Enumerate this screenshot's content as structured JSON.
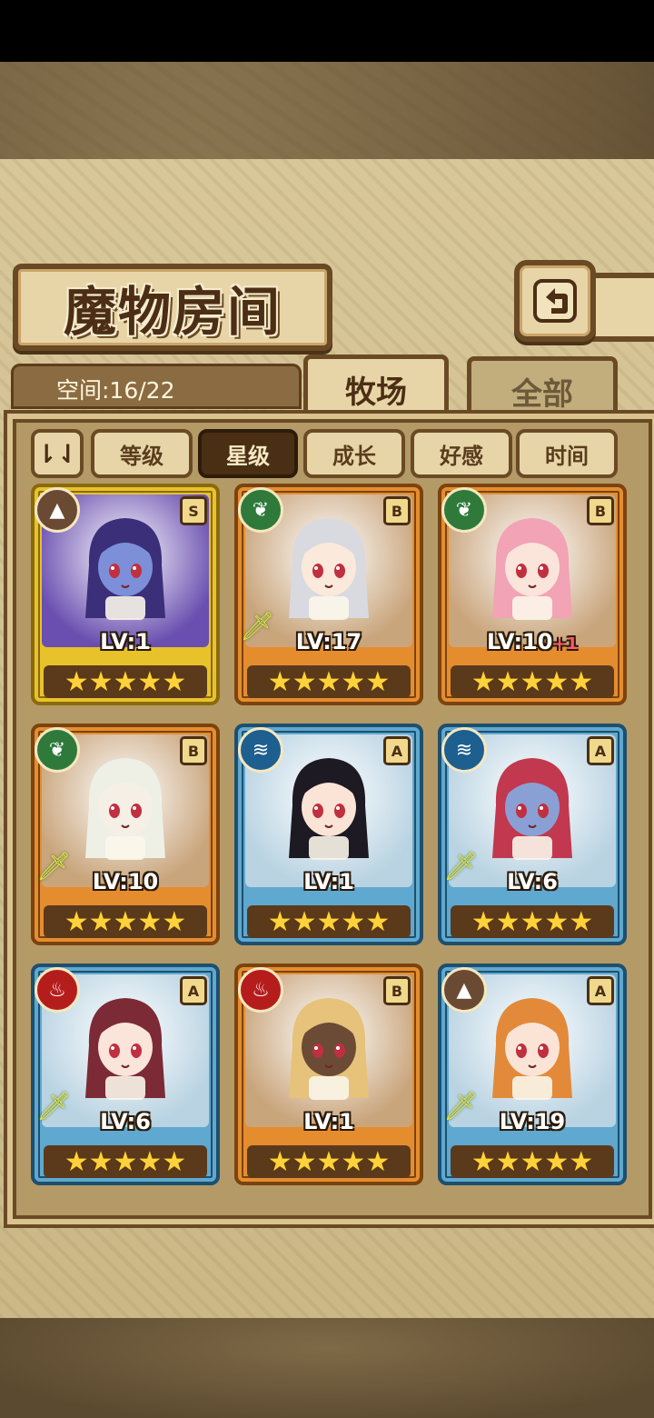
{
  "title": "魔物房间",
  "space_label": "空间:16/22",
  "tabs": [
    {
      "label": "牧场",
      "active": true
    },
    {
      "label": "全部",
      "active": false
    }
  ],
  "sort_icon": "⇂⇃",
  "filters": [
    {
      "label": "等级",
      "selected": false
    },
    {
      "label": "星级",
      "selected": true
    },
    {
      "label": "成长",
      "selected": false
    },
    {
      "label": "好感",
      "selected": false
    },
    {
      "label": "时间",
      "selected": false
    }
  ],
  "stars": "★★★★★",
  "monsters": [
    {
      "level": "LV:1",
      "bonus": "",
      "rank": "S",
      "element": "earth",
      "weapon": false,
      "frame": "gold"
    },
    {
      "level": "LV:17",
      "bonus": "",
      "rank": "B",
      "element": "nature",
      "weapon": true,
      "frame": "orange"
    },
    {
      "level": "LV:10",
      "bonus": "+1",
      "rank": "B",
      "element": "nature",
      "weapon": false,
      "frame": "orange"
    },
    {
      "level": "LV:10",
      "bonus": "",
      "rank": "B",
      "element": "nature",
      "weapon": true,
      "frame": "orange"
    },
    {
      "level": "LV:1",
      "bonus": "",
      "rank": "A",
      "element": "water",
      "weapon": false,
      "frame": "blue"
    },
    {
      "level": "LV:6",
      "bonus": "",
      "rank": "A",
      "element": "water",
      "weapon": true,
      "frame": "blue"
    },
    {
      "level": "LV:6",
      "bonus": "",
      "rank": "A",
      "element": "fire",
      "weapon": true,
      "frame": "blue"
    },
    {
      "level": "LV:1",
      "bonus": "",
      "rank": "B",
      "element": "fire",
      "weapon": false,
      "frame": "orange"
    },
    {
      "level": "LV:19",
      "bonus": "",
      "rank": "A",
      "element": "earth",
      "weapon": true,
      "frame": "blue"
    }
  ]
}
